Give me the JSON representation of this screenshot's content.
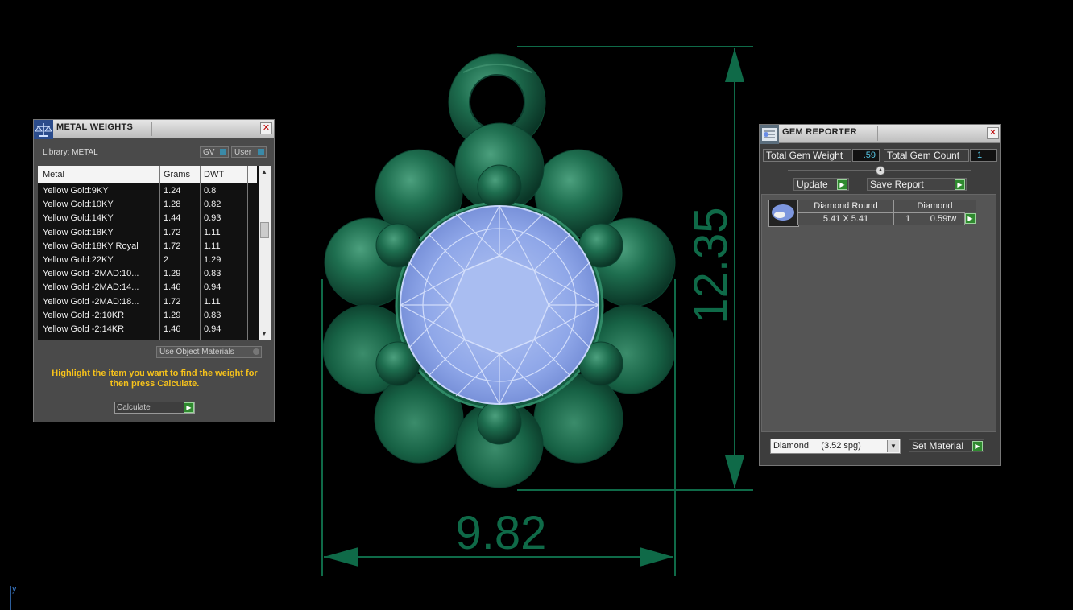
{
  "metal_weights": {
    "title": "METAL WEIGHTS",
    "close": "✕",
    "library_label": "Library: METAL",
    "gv_label": "GV",
    "user_label": "User",
    "columns": [
      "Metal",
      "Grams",
      "DWT"
    ],
    "rows": [
      {
        "metal": "Yellow Gold:9KY",
        "grams": "1.24",
        "dwt": "0.8"
      },
      {
        "metal": "Yellow Gold:10KY",
        "grams": "1.28",
        "dwt": "0.82"
      },
      {
        "metal": "Yellow Gold:14KY",
        "grams": "1.44",
        "dwt": "0.93"
      },
      {
        "metal": "Yellow Gold:18KY",
        "grams": "1.72",
        "dwt": "1.11"
      },
      {
        "metal": "Yellow Gold:18KY Royal",
        "grams": "1.72",
        "dwt": "1.11"
      },
      {
        "metal": "Yellow Gold:22KY",
        "grams": "2",
        "dwt": "1.29"
      },
      {
        "metal": "Yellow Gold -2MAD:10...",
        "grams": "1.29",
        "dwt": "0.83"
      },
      {
        "metal": "Yellow Gold -2MAD:14...",
        "grams": "1.46",
        "dwt": "0.94"
      },
      {
        "metal": "Yellow Gold -2MAD:18...",
        "grams": "1.72",
        "dwt": "1.11"
      },
      {
        "metal": "Yellow Gold -2:10KR",
        "grams": "1.29",
        "dwt": "0.83"
      },
      {
        "metal": "Yellow Gold -2:14KR",
        "grams": "1.46",
        "dwt": "0.94"
      }
    ],
    "use_object_materials": "Use Object Materials",
    "hint": "Highlight the item you want to find the weight for then press Calculate.",
    "calculate_label": "Calculate",
    "hint_color": "#f6c21b"
  },
  "gem_reporter": {
    "title": "GEM REPORTER",
    "close": "✕",
    "total_weight_label": "Total Gem Weight",
    "total_weight_value": ".59",
    "total_count_label": "Total Gem Count",
    "total_count_value": "1",
    "update_label": "Update",
    "save_report_label": "Save Report",
    "gems": [
      {
        "name": "Diamond Round",
        "material": "Diamond",
        "size": "5.41 X 5.41",
        "count": "1",
        "weight": "0.59tw"
      }
    ],
    "material_select": "Diamond     (3.52 spg)",
    "set_material_label": "Set Material"
  },
  "viewport": {
    "dimension_width": "9.82",
    "dimension_height": "12.35",
    "axis_label": "y",
    "metal_color": "#1f6b4d",
    "gem_color": "#8fa8ea",
    "dimension_color": "#0f6a48"
  }
}
